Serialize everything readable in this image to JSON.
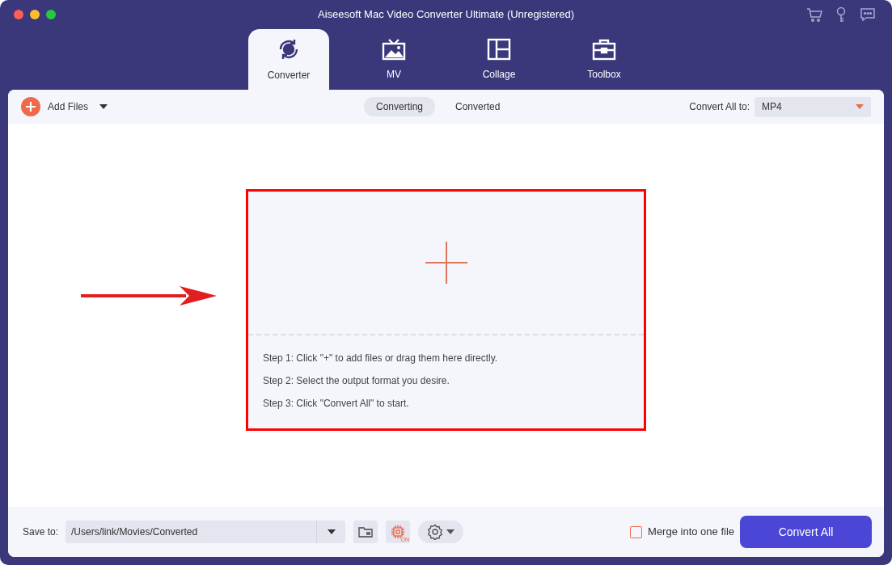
{
  "window": {
    "title": "Aiseesoft Mac Video Converter Ultimate (Unregistered)"
  },
  "tabs": [
    {
      "label": "Converter",
      "kind": "converter",
      "selected": true
    },
    {
      "label": "MV",
      "kind": "mv",
      "selected": false
    },
    {
      "label": "Collage",
      "kind": "collage",
      "selected": false
    },
    {
      "label": "Toolbox",
      "kind": "toolbox",
      "selected": false
    }
  ],
  "toolbar": {
    "add_files": "Add Files",
    "subtabs": [
      {
        "label": "Converting",
        "selected": true
      },
      {
        "label": "Converted",
        "selected": false
      }
    ],
    "convert_all_to_label": "Convert All to:",
    "format": "MP4"
  },
  "drop_zone": {
    "steps": [
      "Step 1: Click \"+\" to add files or drag them here directly.",
      "Step 2: Select the output format you desire.",
      "Step 3: Click \"Convert All\" to start."
    ]
  },
  "bottom_bar": {
    "save_to_label": "Save to:",
    "save_path": "/Users/link/Movies/Converted",
    "gpu_badge": "ON",
    "merge": {
      "label": "Merge into one file",
      "checked": false
    },
    "convert_all_button": "Convert All"
  }
}
